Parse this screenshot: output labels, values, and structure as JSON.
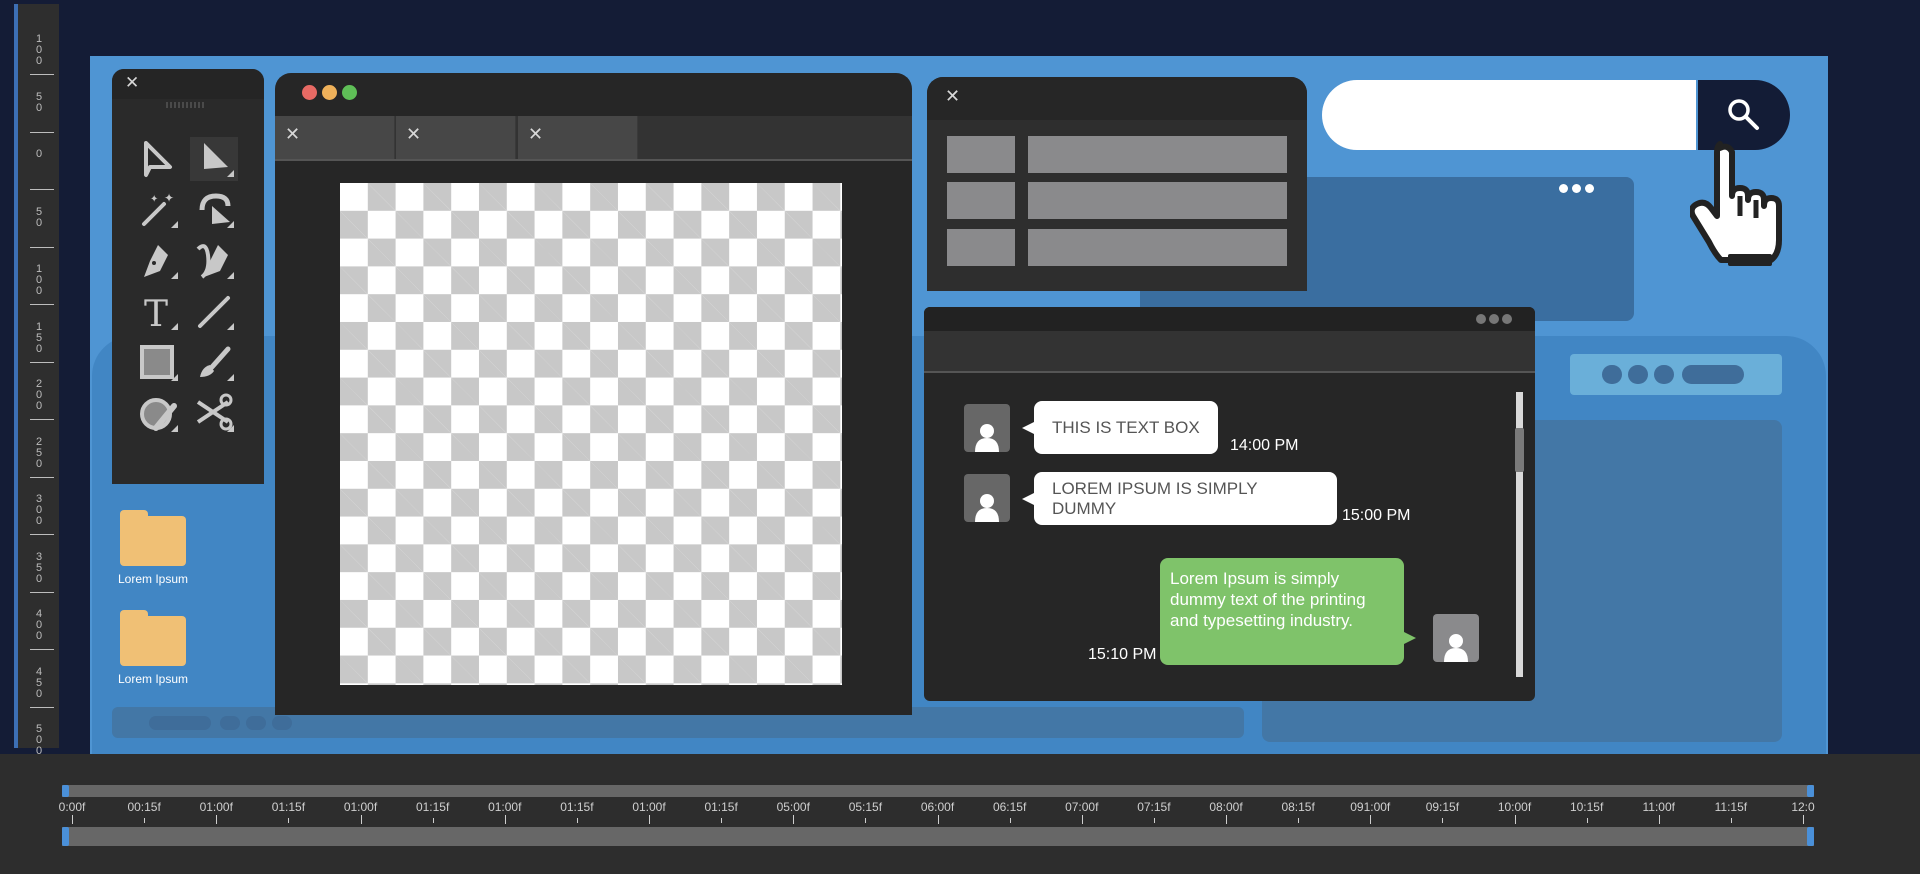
{
  "ruler": {
    "labels": [
      "100",
      "50",
      "0",
      "50",
      "100",
      "150",
      "200",
      "250",
      "300",
      "350",
      "400",
      "450",
      "500"
    ]
  },
  "toolbox": {
    "tools": [
      {
        "name": "selection-tool-icon",
        "glyph": "select",
        "selected": false
      },
      {
        "name": "direct-selection-tool-icon",
        "glyph": "direct",
        "selected": true
      },
      {
        "name": "magic-wand-icon",
        "glyph": "wand",
        "selected": false
      },
      {
        "name": "lasso-icon",
        "glyph": "lasso",
        "selected": false
      },
      {
        "name": "pen-tool-icon",
        "glyph": "pen",
        "selected": false
      },
      {
        "name": "curvature-pen-icon",
        "glyph": "curvepen",
        "selected": false
      },
      {
        "name": "type-tool-icon",
        "glyph": "T",
        "selected": false
      },
      {
        "name": "line-tool-icon",
        "glyph": "line",
        "selected": false
      },
      {
        "name": "rectangle-tool-icon",
        "glyph": "rect",
        "selected": false
      },
      {
        "name": "paintbrush-icon",
        "glyph": "brush",
        "selected": false
      },
      {
        "name": "shape-builder-icon",
        "glyph": "shaper",
        "selected": false
      },
      {
        "name": "scissors-icon",
        "glyph": "scissors",
        "selected": false
      }
    ]
  },
  "desktop": {
    "folders": [
      {
        "label": "Lorem Ipsum"
      },
      {
        "label": "Lorem Ipsum"
      }
    ]
  },
  "canvas_window": {
    "tabs": [
      {
        "close": "×"
      },
      {
        "close": "×"
      },
      {
        "close": "×"
      }
    ],
    "traffic_lights": {
      "red": "#e76a64",
      "yellow": "#efb15a",
      "green": "#5fbf57"
    }
  },
  "icons": {
    "close": "✕"
  },
  "chat": {
    "messages": [
      {
        "text": "THIS IS TEXT BOX",
        "time": "14:00 PM",
        "side": "left"
      },
      {
        "text": "LOREM IPSUM IS SIMPLY DUMMY",
        "time": "15:00 PM",
        "side": "left"
      },
      {
        "text": "Lorem Ipsum is simply dummy text of the printing and typesetting industry.",
        "time": "15:10 PM",
        "side": "right"
      }
    ],
    "scroll_position": 0.15
  },
  "search": {
    "value": "",
    "placeholder": ""
  },
  "timeline": {
    "labels": [
      "0:00f",
      "00:15f",
      "01:00f",
      "01:15f",
      "01:00f",
      "01:15f",
      "01:00f",
      "01:15f",
      "01:00f",
      "01:15f",
      "05:00f",
      "05:15f",
      "06:00f",
      "06:15f",
      "07:00f",
      "07:15f",
      "08:00f",
      "08:15f",
      "091:00f",
      "09:15f",
      "10:00f",
      "10:15f",
      "11:00f",
      "11:15f",
      "12:0"
    ],
    "playhead_start": 0,
    "playhead_end": 1
  },
  "colors": {
    "accent_blue": "#4f95d3",
    "folder": "#f0c075",
    "chat_green": "#7fc36a",
    "navy": "#131c36"
  }
}
